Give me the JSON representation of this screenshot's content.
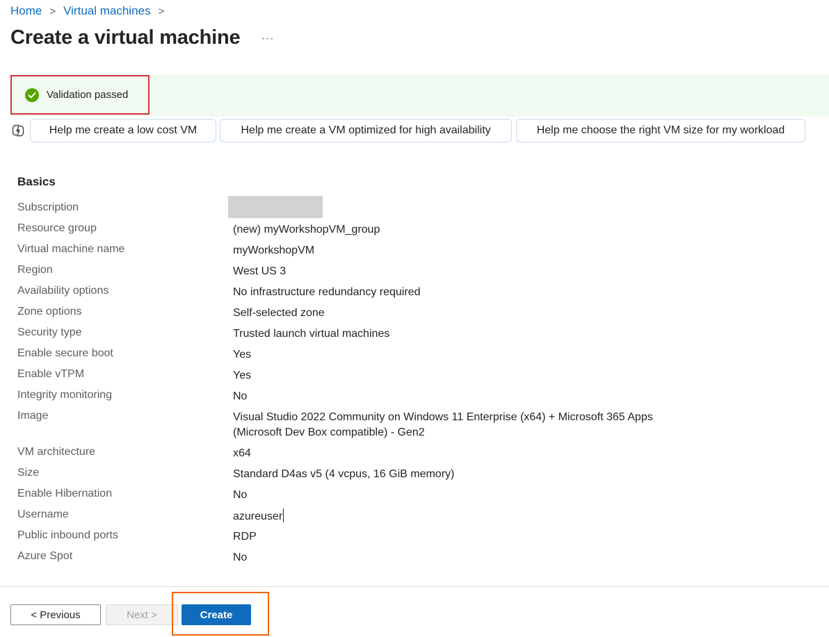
{
  "breadcrumb": {
    "home": "Home",
    "virtual_machines": "Virtual machines",
    "separator": ">"
  },
  "header": {
    "title": "Create a virtual machine",
    "more": "···"
  },
  "validation": {
    "text": "Validation passed",
    "color": "#57a300"
  },
  "copilot": {
    "icon": "copilot-icon",
    "suggestions": [
      "Help me create a low cost VM",
      "Help me create a VM optimized for high availability",
      "Help me choose the right VM size for my workload"
    ]
  },
  "basics": {
    "title": "Basics",
    "rows": [
      {
        "label": "Subscription",
        "value": ""
      },
      {
        "label": "Resource group",
        "value": "(new) myWorkshopVM_group"
      },
      {
        "label": "Virtual machine name",
        "value": "myWorkshopVM"
      },
      {
        "label": "Region",
        "value": "West US 3"
      },
      {
        "label": "Availability options",
        "value": "No infrastructure redundancy required"
      },
      {
        "label": "Zone options",
        "value": "Self-selected zone"
      },
      {
        "label": "Security type",
        "value": "Trusted launch virtual machines"
      },
      {
        "label": "Enable secure boot",
        "value": "Yes"
      },
      {
        "label": "Enable vTPM",
        "value": "Yes"
      },
      {
        "label": "Integrity monitoring",
        "value": "No"
      },
      {
        "label": "Image",
        "value": "Visual Studio 2022 Community on Windows 11 Enterprise (x64) + Microsoft 365 Apps",
        "value2": "(Microsoft Dev Box compatible) - Gen2"
      },
      {
        "label": "VM architecture",
        "value": "x64"
      },
      {
        "label": "Size",
        "value": "Standard D4as v5 (4 vcpus, 16 GiB memory)"
      },
      {
        "label": "Enable Hibernation",
        "value": "No"
      },
      {
        "label": "Username",
        "value": "azureuser"
      },
      {
        "label": "Public inbound ports",
        "value": "RDP"
      },
      {
        "label": "Azure Spot",
        "value": "No"
      }
    ]
  },
  "footer": {
    "previous": "< Previous",
    "next": "Next >",
    "create": "Create"
  },
  "colors": {
    "accent": "#0f6cbd",
    "validation_highlight": "#d13438",
    "create_highlight": "#f7630c",
    "banner_bg": "#f1faf1"
  }
}
